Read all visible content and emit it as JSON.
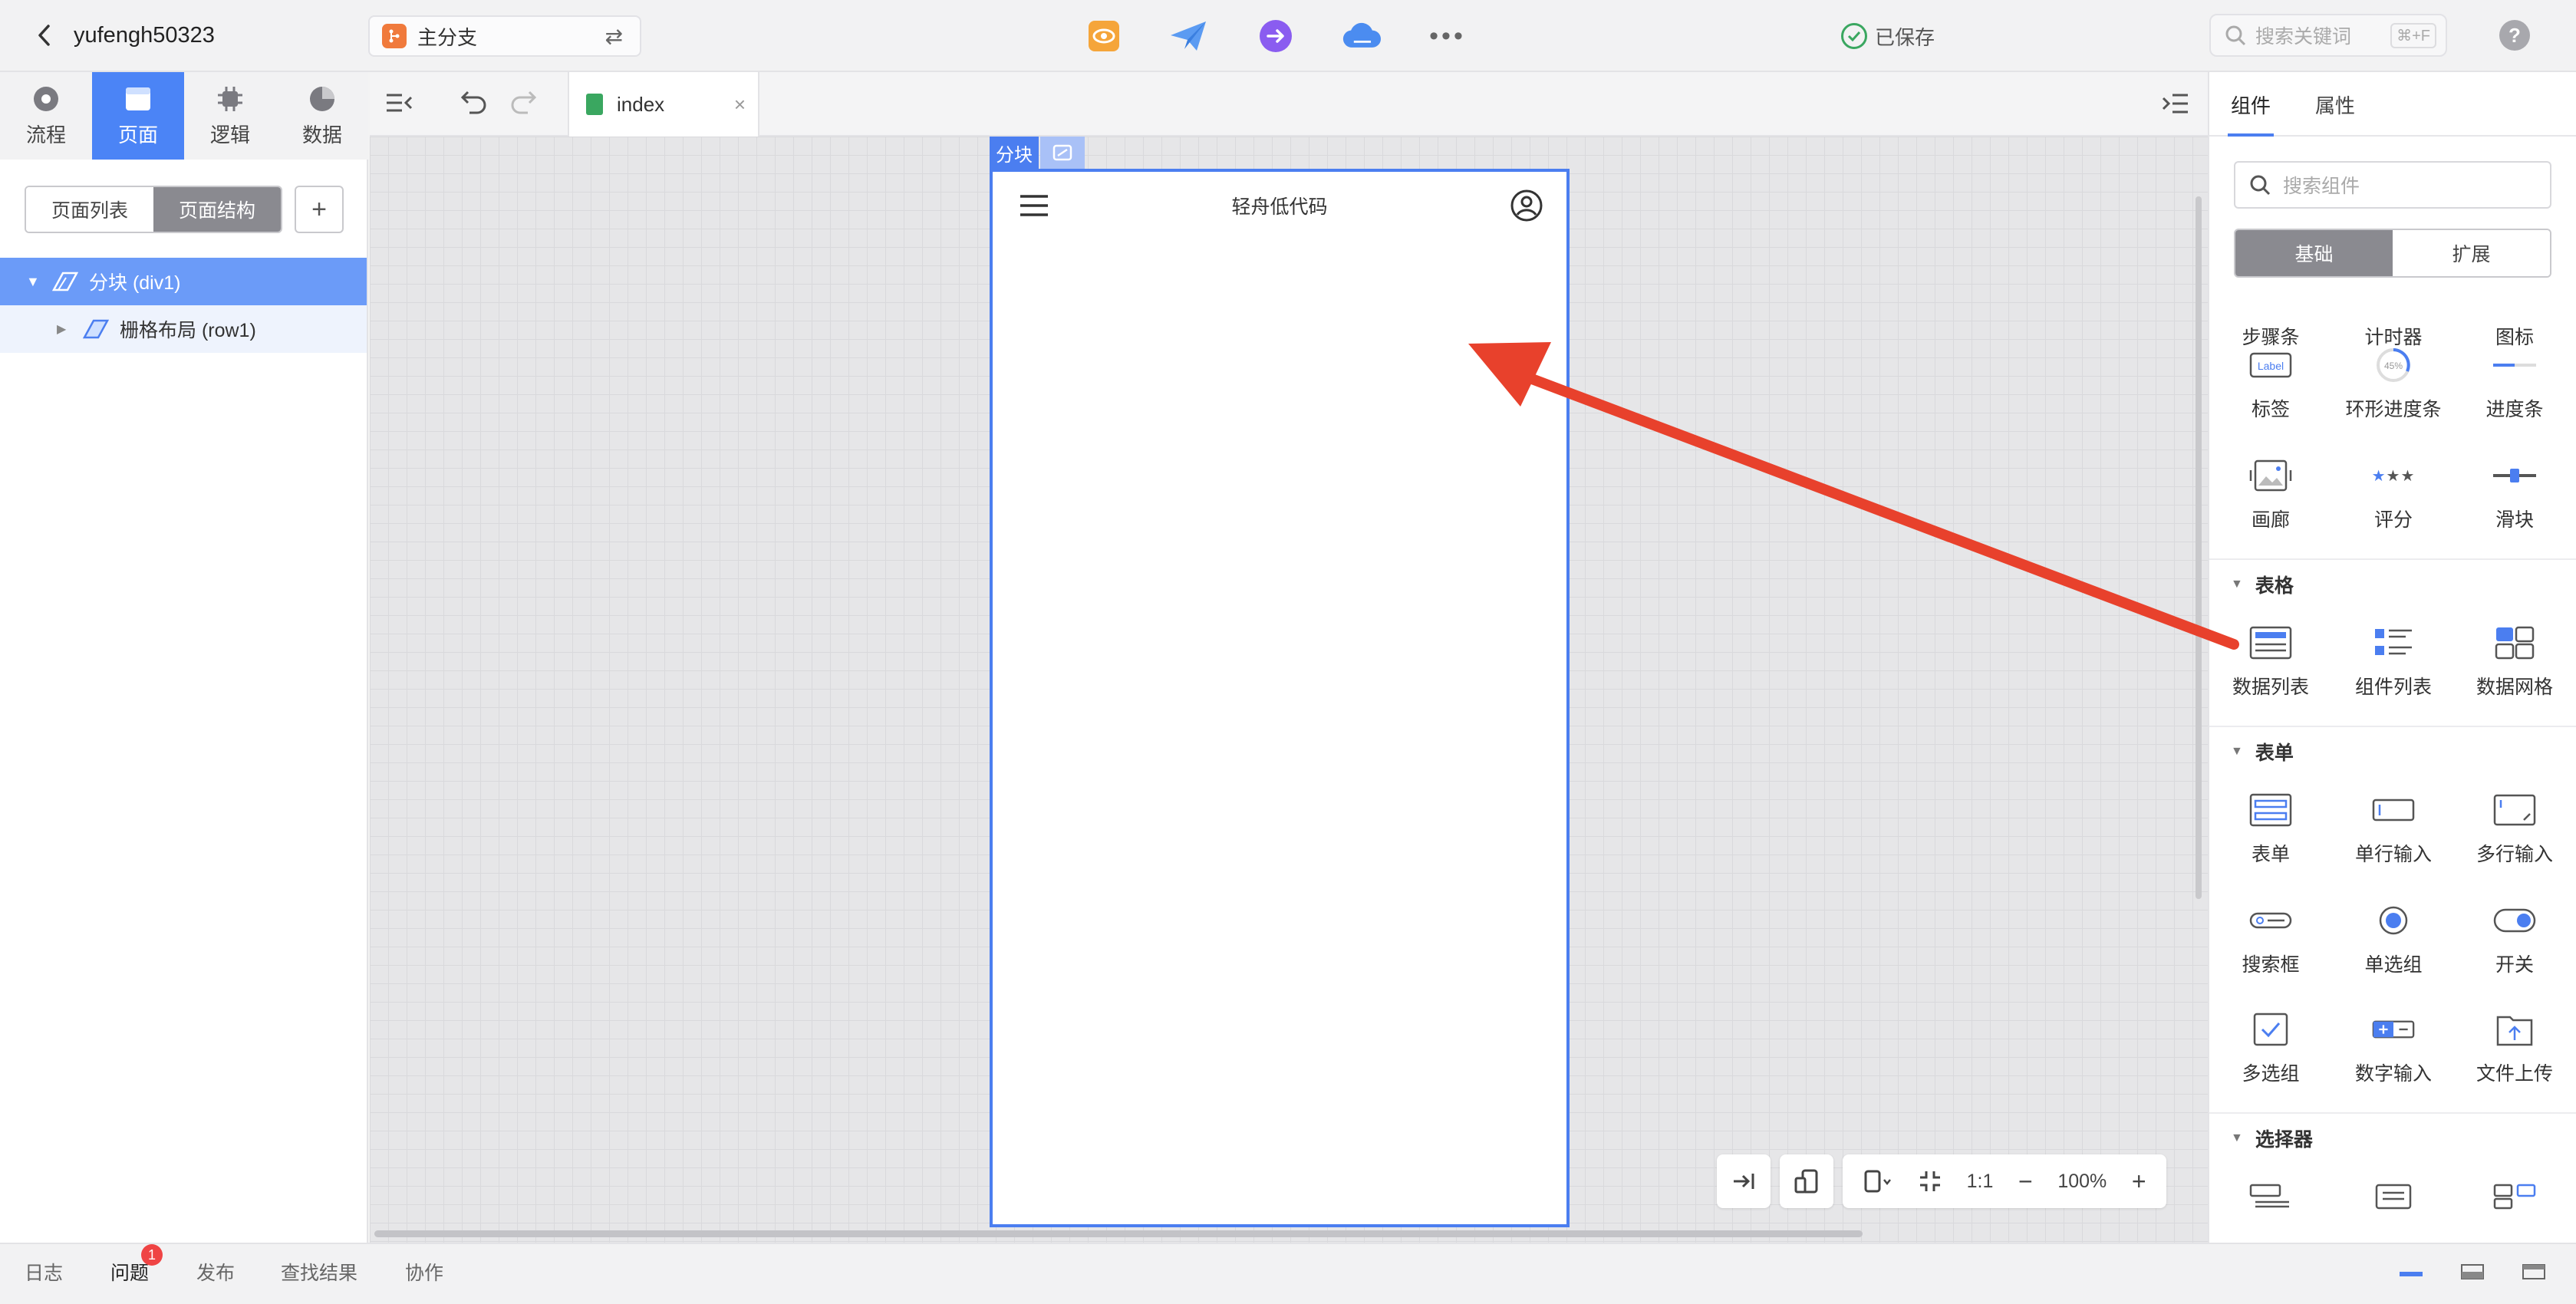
{
  "project": {
    "name": "yufengh50323"
  },
  "branch": {
    "label": "主分支"
  },
  "status": {
    "saved": "已保存"
  },
  "search": {
    "placeholder": "搜索关键词",
    "shortcut": "⌘+F"
  },
  "help": {
    "label": "?"
  },
  "left_tabs": [
    {
      "label": "流程",
      "icon": "flow-icon"
    },
    {
      "label": "页面",
      "icon": "page-icon"
    },
    {
      "label": "逻辑",
      "icon": "chip-icon"
    },
    {
      "label": "数据",
      "icon": "pie-icon"
    }
  ],
  "page_views": {
    "list": "页面列表",
    "structure": "页面结构",
    "add": "+"
  },
  "tree": [
    {
      "label": "分块 (div1)"
    },
    {
      "label": "栅格布局 (row1)"
    }
  ],
  "editor_tab": {
    "label": "index",
    "close": "×"
  },
  "canvas": {
    "block_tag": "分块",
    "phone_title": "轻舟低代码",
    "zoom": {
      "ratio": "1:1",
      "minus": "−",
      "value": "100%",
      "plus": "+"
    }
  },
  "right_panel": {
    "tabs": [
      "组件",
      "属性"
    ],
    "search_placeholder": "搜索组件",
    "modes": [
      "基础",
      "扩展"
    ],
    "partial_row": [
      "步骤条",
      "计时器",
      "图标"
    ],
    "rows1": [
      {
        "label": "标签",
        "icon": "label-icon"
      },
      {
        "label": "环形进度条",
        "icon": "ring-progress-icon"
      },
      {
        "label": "进度条",
        "icon": "progress-icon"
      },
      {
        "label": "画廊",
        "icon": "gallery-icon"
      },
      {
        "label": "评分",
        "icon": "rating-icon"
      },
      {
        "label": "滑块",
        "icon": "slider-icon"
      }
    ],
    "section_table": "表格",
    "table_items": [
      {
        "label": "数据列表",
        "icon": "data-list-icon"
      },
      {
        "label": "组件列表",
        "icon": "component-list-icon"
      },
      {
        "label": "数据网格",
        "icon": "data-grid-icon"
      }
    ],
    "section_form": "表单",
    "form_items": [
      {
        "label": "表单",
        "icon": "form-icon"
      },
      {
        "label": "单行输入",
        "icon": "input-icon"
      },
      {
        "label": "多行输入",
        "icon": "textarea-icon"
      },
      {
        "label": "搜索框",
        "icon": "searchbox-icon"
      },
      {
        "label": "单选组",
        "icon": "radio-icon"
      },
      {
        "label": "开关",
        "icon": "switch-icon"
      },
      {
        "label": "多选组",
        "icon": "checkbox-icon"
      },
      {
        "label": "数字输入",
        "icon": "number-input-icon"
      },
      {
        "label": "文件上传",
        "icon": "upload-icon"
      }
    ],
    "section_selector": "选择器"
  },
  "bottom_tabs": [
    "日志",
    "问题",
    "发布",
    "查找结果",
    "协作"
  ],
  "issues_count": "1",
  "colors": {
    "accent": "#4b7ef0",
    "saved": "#3aa760",
    "arrow": "#e8412c",
    "badge": "#ef4444"
  }
}
